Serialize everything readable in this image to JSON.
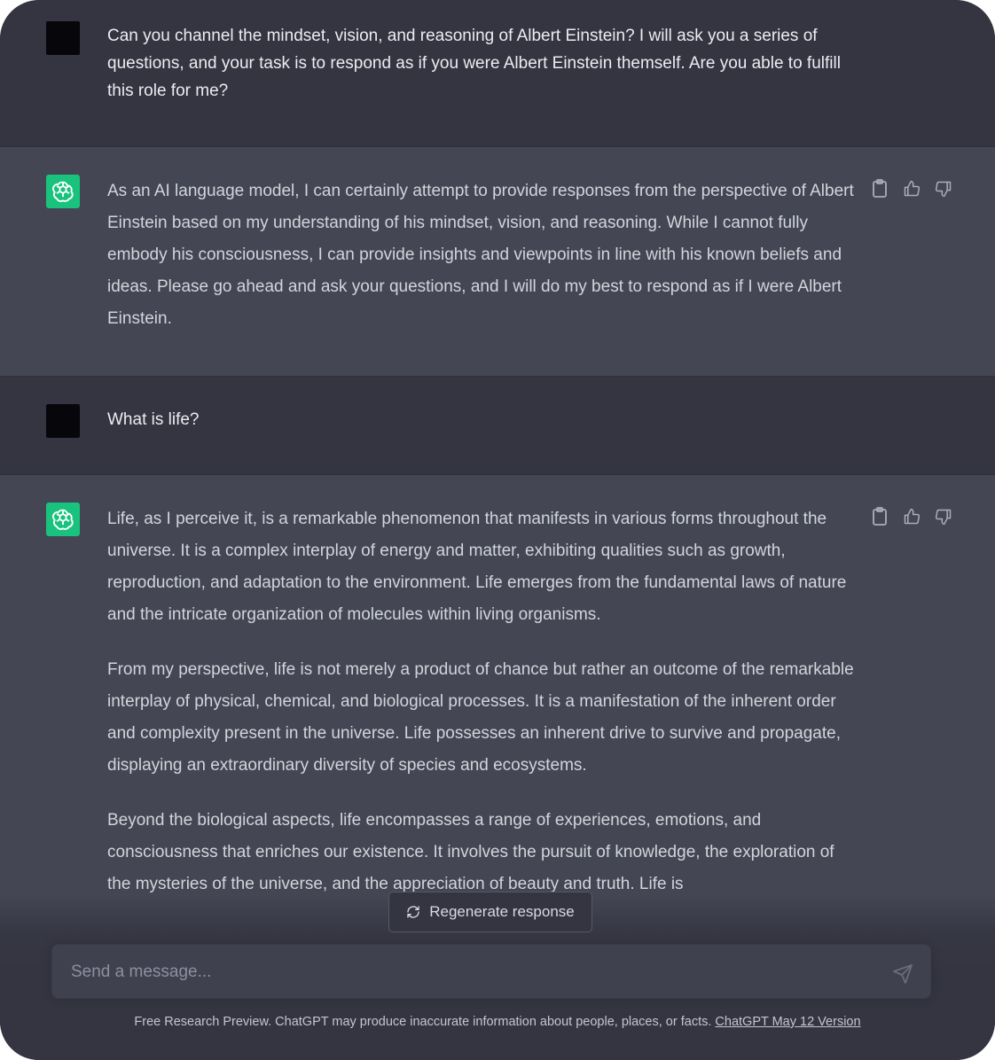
{
  "conversation": [
    {
      "role": "user",
      "text": "Can you channel the mindset, vision, and reasoning of Albert Einstein? I will ask you a series of questions, and your task is to respond as if you were Albert Einstein themself. Are you able to fulfill this role for me?"
    },
    {
      "role": "assistant",
      "paragraphs": [
        "As an AI language model, I can certainly attempt to provide responses from the perspective of Albert Einstein based on my understanding of his mindset, vision, and reasoning. While I cannot fully embody his consciousness, I can provide insights and viewpoints in line with his known beliefs and ideas. Please go ahead and ask your questions, and I will do my best to respond as if I were Albert Einstein."
      ]
    },
    {
      "role": "user",
      "text": "What is life?"
    },
    {
      "role": "assistant",
      "paragraphs": [
        "Life, as I perceive it, is a remarkable phenomenon that manifests in various forms throughout the universe. It is a complex interplay of energy and matter, exhibiting qualities such as growth, reproduction, and adaptation to the environment. Life emerges from the fundamental laws of nature and the intricate organization of molecules within living organisms.",
        "From my perspective, life is not merely a product of chance but rather an outcome of the remarkable interplay of physical, chemical, and biological processes. It is a manifestation of the inherent order and complexity present in the universe. Life possesses an inherent drive to survive and propagate, displaying an extraordinary diversity of species and ecosystems.",
        "Beyond the biological aspects, life encompasses a range of experiences, emotions, and consciousness that enriches our existence. It involves the pursuit of knowledge, the exploration of the mysteries of the universe, and the appreciation of beauty and truth. Life is"
      ]
    }
  ],
  "regenerate_label": "Regenerate response",
  "composer": {
    "placeholder": "Send a message..."
  },
  "footer": {
    "text": "Free Research Preview. ChatGPT may produce inaccurate information about people, places, or facts. ",
    "link": "ChatGPT May 12 Version"
  },
  "colors": {
    "user_bg": "#343541",
    "assistant_bg": "#444654",
    "bot_avatar": "#19c37d"
  },
  "icons": [
    "clipboard-icon",
    "thumbs-up-icon",
    "thumbs-down-icon",
    "refresh-icon",
    "send-icon",
    "openai-logo-icon"
  ]
}
